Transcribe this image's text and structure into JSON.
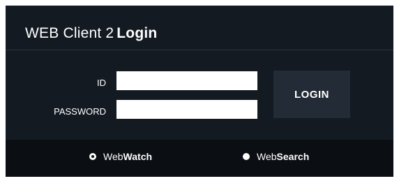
{
  "header": {
    "title_regular": "WEB Client 2",
    "title_bold": "Login"
  },
  "form": {
    "id_label": "ID",
    "id_value": "",
    "password_label": "PASSWORD",
    "password_value": "",
    "login_label": "LOGIN"
  },
  "footer": {
    "options": [
      {
        "prefix": "Web",
        "bold": "Watch",
        "selected": true
      },
      {
        "prefix": "Web",
        "bold": "Search",
        "selected": false
      }
    ]
  },
  "colors": {
    "panel": "#141a22",
    "footer": "#0b0e13",
    "button": "#222b36",
    "text": "#ffffff"
  }
}
